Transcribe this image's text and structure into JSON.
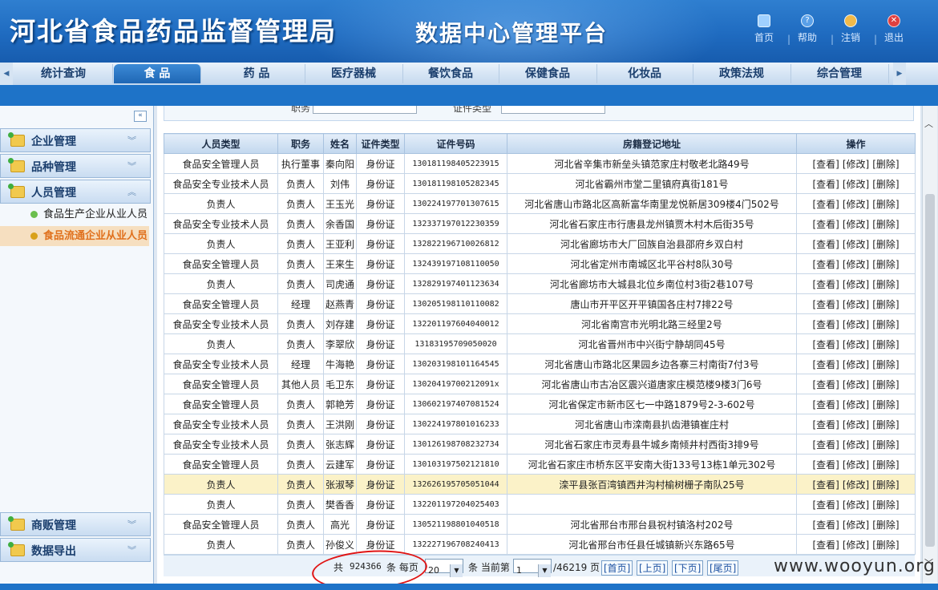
{
  "header": {
    "title": "河北省食品药品监督管理局",
    "subtitle": "数据中心管理平台",
    "links": [
      {
        "label": "首页",
        "icon": "monitor-icon"
      },
      {
        "label": "帮助",
        "icon": "help-icon"
      },
      {
        "label": "注销",
        "icon": "users-icon"
      },
      {
        "label": "退出",
        "icon": "close-icon"
      }
    ]
  },
  "nav": {
    "tabs": [
      "统计查询",
      "食 品",
      "药 品",
      "医疗器械",
      "餐饮食品",
      "保健食品",
      "化妆品",
      "政策法规",
      "综合管理"
    ],
    "active": "食 品"
  },
  "sidebar": {
    "sections": [
      {
        "label": "企业管理",
        "state": "collapsed"
      },
      {
        "label": "品种管理",
        "state": "collapsed"
      },
      {
        "label": "人员管理",
        "state": "expanded"
      }
    ],
    "sub_items": [
      {
        "label": "食品生产企业从业人员",
        "active": false
      },
      {
        "label": "食品流通企业从业人员",
        "active": true
      }
    ],
    "bottom_sections": [
      {
        "label": "商贩管理"
      },
      {
        "label": "数据导出"
      }
    ]
  },
  "filters": {
    "label_left": "职务",
    "label_right": "证件类型"
  },
  "table": {
    "headers": [
      "人员类型",
      "职务",
      "姓名",
      "证件类型",
      "证件号码",
      "房籍登记地址",
      "操作"
    ],
    "actions": [
      "[查看]",
      "[修改]",
      "[删除]"
    ],
    "highlight_index": 16,
    "rows": [
      [
        "食品安全管理人员",
        "执行董事",
        "秦向阳",
        "身份证",
        "130181198405223915",
        "河北省辛集市新垒头镇范家庄村敬老北路49号"
      ],
      [
        "食品安全专业技术人员",
        "负责人",
        "刘伟",
        "身份证",
        "130181198105282345",
        "河北省霸州市堂二里镇府真街181号"
      ],
      [
        "负责人",
        "负责人",
        "王玉光",
        "身份证",
        "130224197701307615",
        "河北省唐山市路北区高新富华南里龙悦新居309楼4门502号"
      ],
      [
        "食品安全专业技术人员",
        "负责人",
        "余香国",
        "身份证",
        "132337197012230359",
        "河北省石家庄市行唐县龙州镇贾木村木后街35号"
      ],
      [
        "负责人",
        "负责人",
        "王亚利",
        "身份证",
        "132822196710026812",
        "河北省廊坊市大厂回族自治县邵府乡双白村"
      ],
      [
        "食品安全管理人员",
        "负责人",
        "王来生",
        "身份证",
        "132439197108110050",
        "河北省定州市南城区北平谷村8队30号"
      ],
      [
        "负责人",
        "负责人",
        "司虎通",
        "身份证",
        "132829197401123634",
        "河北省廊坊市大城县北位乡南位村3街2巷107号"
      ],
      [
        "食品安全管理人员",
        "经理",
        "赵燕青",
        "身份证",
        "130205198110110082",
        "唐山市开平区开平镇国各庄村7排22号"
      ],
      [
        "食品安全专业技术人员",
        "负责人",
        "刘存建",
        "身份证",
        "132201197604040012",
        "河北省南宫市光明北路三经里2号"
      ],
      [
        "负责人",
        "负责人",
        "李翠欣",
        "身份证",
        "13183195709050020",
        "河北省晋州市中兴街宁静胡同45号"
      ],
      [
        "食品安全专业技术人员",
        "经理",
        "牛海艳",
        "身份证",
        "130203198101164545",
        "河北省唐山市路北区果园乡边各寨三村南街7付3号"
      ],
      [
        "食品安全管理人员",
        "其他人员",
        "毛卫东",
        "身份证",
        "13020419700212091x",
        "河北省唐山市古冶区震兴道唐家庄模范楼9楼3门6号"
      ],
      [
        "食品安全管理人员",
        "负责人",
        "郭艳芳",
        "身份证",
        "130602197407081524",
        "河北省保定市新市区七一中路1879号2-3-602号"
      ],
      [
        "食品安全专业技术人员",
        "负责人",
        "王洪刚",
        "身份证",
        "130224197801016233",
        "河北省唐山市滦南县扒齿港镇崔庄村"
      ],
      [
        "食品安全专业技术人员",
        "负责人",
        "张志辉",
        "身份证",
        "130126198708232734",
        "河北省石家庄市灵寿县牛城乡南倾井村西街3排9号"
      ],
      [
        "食品安全管理人员",
        "负责人",
        "云建军",
        "身份证",
        "130103197502121810",
        "河北省石家庄市桥东区平安南大街133号13栋1单元302号"
      ],
      [
        "负责人",
        "负责人",
        "张淑琴",
        "身份证",
        "132626195705051044",
        "滦平县张百湾镇西井沟村榆树栅子南队25号"
      ],
      [
        "负责人",
        "负责人",
        "樊香香",
        "身份证",
        "132201197204025403",
        ""
      ],
      [
        "食品安全管理人员",
        "负责人",
        "高光",
        "身份证",
        "130521198801040518",
        "河北省邢台市邢台县祝村镇洛村202号"
      ],
      [
        "负责人",
        "负责人",
        "孙俊义",
        "身份证",
        "132227196708240413",
        "河北省邢台市任县任城镇新兴东路65号"
      ]
    ]
  },
  "pager": {
    "total_prefix": "共",
    "total": "924366",
    "total_suffix": "条 每页",
    "per_page": "20",
    "mid": "条 当前第",
    "current": "1",
    "pages": "/46219 页",
    "buttons": [
      "[首页]",
      "[上页]",
      "[下页]",
      "[尾页]"
    ]
  },
  "watermark": "www.wooyun.org",
  "colors": {
    "brand_blue": "#1e73c8",
    "highlight_row": "#fbf2c8",
    "active_sub": "#e0701c",
    "annotation_red": "#e01414"
  }
}
